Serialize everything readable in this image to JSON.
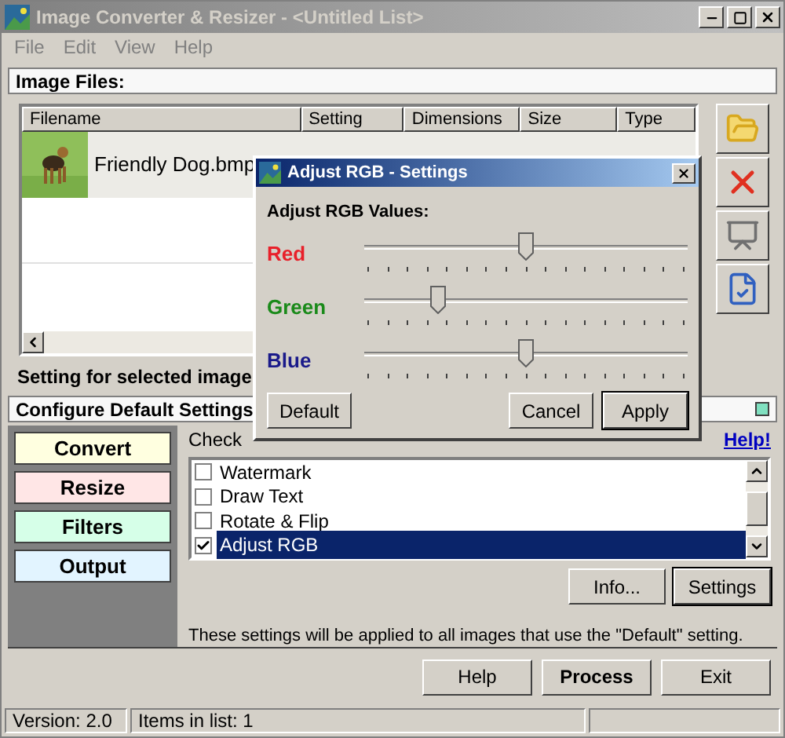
{
  "window": {
    "title": "Image Converter & Resizer - <Untitled List>"
  },
  "menu": [
    "File",
    "Edit",
    "View",
    "Help"
  ],
  "image_files": {
    "heading": "Image Files:",
    "columns": [
      "Filename",
      "Setting",
      "Dimensions",
      "Size",
      "Type"
    ],
    "rows": [
      {
        "filename": "Friendly Dog.bmp",
        "kind": "picture"
      }
    ],
    "setting_label": "Setting for selected image"
  },
  "configure": {
    "heading": "Configure Default Settings",
    "nav": [
      {
        "label": "Convert",
        "color": "#ffffe0"
      },
      {
        "label": "Resize",
        "color": "#ffe6e6"
      },
      {
        "label": "Filters",
        "color": "#d6ffe8"
      },
      {
        "label": "Output",
        "color": "#e2f4ff"
      }
    ],
    "check_label": "Check",
    "help_link": "Help!",
    "options": [
      {
        "label": "Watermark",
        "checked": false,
        "selected": false
      },
      {
        "label": "Draw Text",
        "checked": false,
        "selected": false
      },
      {
        "label": "Rotate & Flip",
        "checked": false,
        "selected": false
      },
      {
        "label": "Adjust RGB",
        "checked": true,
        "selected": true
      }
    ],
    "buttons": [
      {
        "label": "Info...",
        "default": false
      },
      {
        "label": "Settings",
        "default": true
      }
    ],
    "note": "These settings will be applied to all images that use the \"Default\" setting."
  },
  "actions": [
    {
      "label": "Help",
      "default": false
    },
    {
      "label": "Process",
      "default": true
    },
    {
      "label": "Exit",
      "default": false
    }
  ],
  "status_bar": [
    "Version: 2.0",
    "Items in list: 1"
  ],
  "dialog": {
    "title": "Adjust RGB - Settings",
    "heading": "Adjust RGB Values:",
    "channels": [
      {
        "name": "Red",
        "color": "#e8202a",
        "level": 0.5
      },
      {
        "name": "Green",
        "color": "#1a8a1a",
        "level": 0.23
      },
      {
        "name": "Blue",
        "color": "#1a1a8a",
        "level": 0.5
      }
    ],
    "buttons": [
      {
        "label": "Default",
        "default": false
      },
      {
        "label": "Cancel",
        "default": false
      },
      {
        "label": "Apply",
        "default": true
      }
    ]
  }
}
